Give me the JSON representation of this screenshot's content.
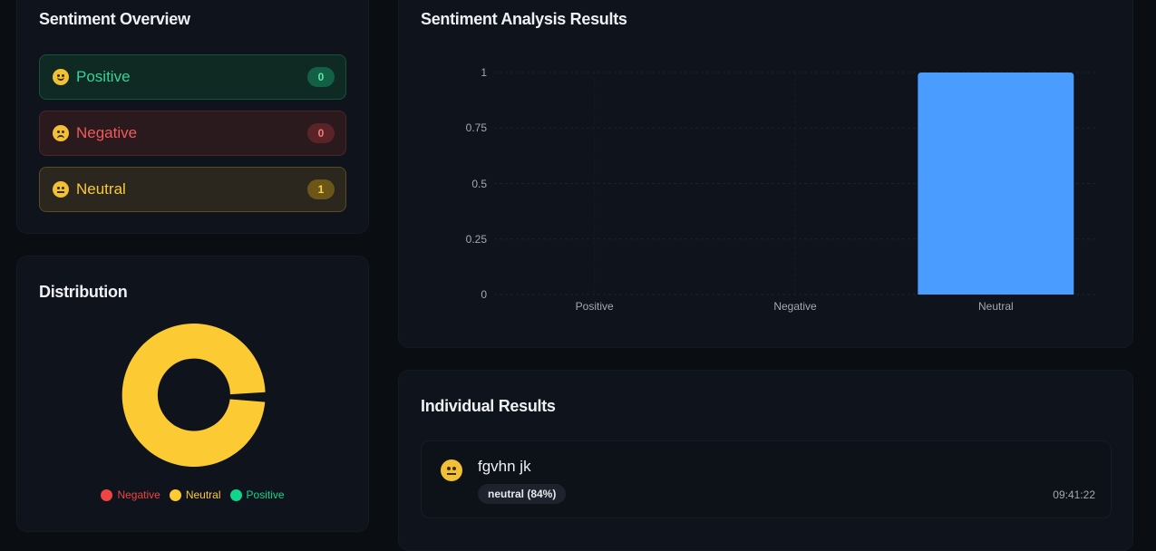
{
  "overview": {
    "title": "Sentiment Overview",
    "items": [
      {
        "label": "Positive",
        "count": "0",
        "icon": "smile-emoji-icon"
      },
      {
        "label": "Negative",
        "count": "0",
        "icon": "sad-emoji-icon"
      },
      {
        "label": "Neutral",
        "count": "1",
        "icon": "neutral-emoji-icon"
      }
    ]
  },
  "distribution": {
    "title": "Distribution",
    "legend": [
      {
        "label": "Negative",
        "color": "#ef4444"
      },
      {
        "label": "Neutral",
        "color": "#fccb33"
      },
      {
        "label": "Positive",
        "color": "#10d58a"
      }
    ]
  },
  "results_chart": {
    "title": "Sentiment Analysis Results"
  },
  "chart_data": {
    "type": "bar",
    "categories": [
      "Positive",
      "Negative",
      "Neutral"
    ],
    "values": [
      0,
      0,
      1
    ],
    "title": "Sentiment Analysis Results",
    "ylim": [
      0,
      1
    ],
    "yticks": [
      "1",
      "0.75",
      "0.5",
      "0.25",
      "0"
    ],
    "bar_color": "#4a9cff",
    "grid": true
  },
  "individual": {
    "title": "Individual Results",
    "items": [
      {
        "text": "fgvhn jk",
        "label": "neutral (84%)",
        "time": "09:41:22",
        "icon": "neutral-emoji-icon"
      }
    ]
  },
  "colors": {
    "positive": "#34d399",
    "negative": "#f05a5a",
    "neutral": "#f8c93a"
  }
}
